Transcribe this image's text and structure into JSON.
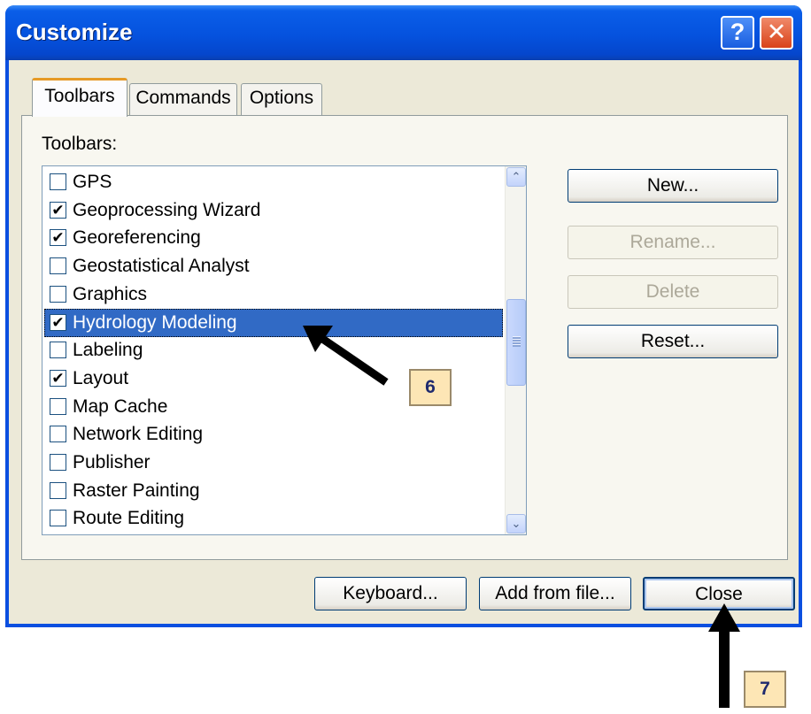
{
  "dialog": {
    "title": "Customize",
    "help_label": "?",
    "close_label": "✕",
    "tabs": [
      {
        "label": "Toolbars"
      },
      {
        "label": "Commands"
      },
      {
        "label": "Options"
      }
    ],
    "toolbars_label": "Toolbars:",
    "toolbar_items": [
      {
        "label": "GPS",
        "checked": false
      },
      {
        "label": "Geoprocessing Wizard",
        "checked": true
      },
      {
        "label": "Georeferencing",
        "checked": true
      },
      {
        "label": "Geostatistical Analyst",
        "checked": false
      },
      {
        "label": "Graphics",
        "checked": false
      },
      {
        "label": "Hydrology Modeling",
        "checked": true,
        "selected": true
      },
      {
        "label": "Labeling",
        "checked": false
      },
      {
        "label": "Layout",
        "checked": true
      },
      {
        "label": "Map Cache",
        "checked": false
      },
      {
        "label": "Network Editing",
        "checked": false
      },
      {
        "label": "Publisher",
        "checked": false
      },
      {
        "label": "Raster Painting",
        "checked": false
      },
      {
        "label": "Route Editing",
        "checked": false
      }
    ],
    "side_buttons": {
      "new": "New...",
      "rename": "Rename...",
      "delete": "Delete",
      "reset": "Reset..."
    },
    "bottom_buttons": {
      "keyboard": "Keyboard...",
      "add_from_file": "Add from file...",
      "close": "Close"
    },
    "scroll_up_glyph": "⌃",
    "scroll_down_glyph": "⌄"
  },
  "annotations": {
    "step6_label": "6",
    "step7_label": "7"
  }
}
